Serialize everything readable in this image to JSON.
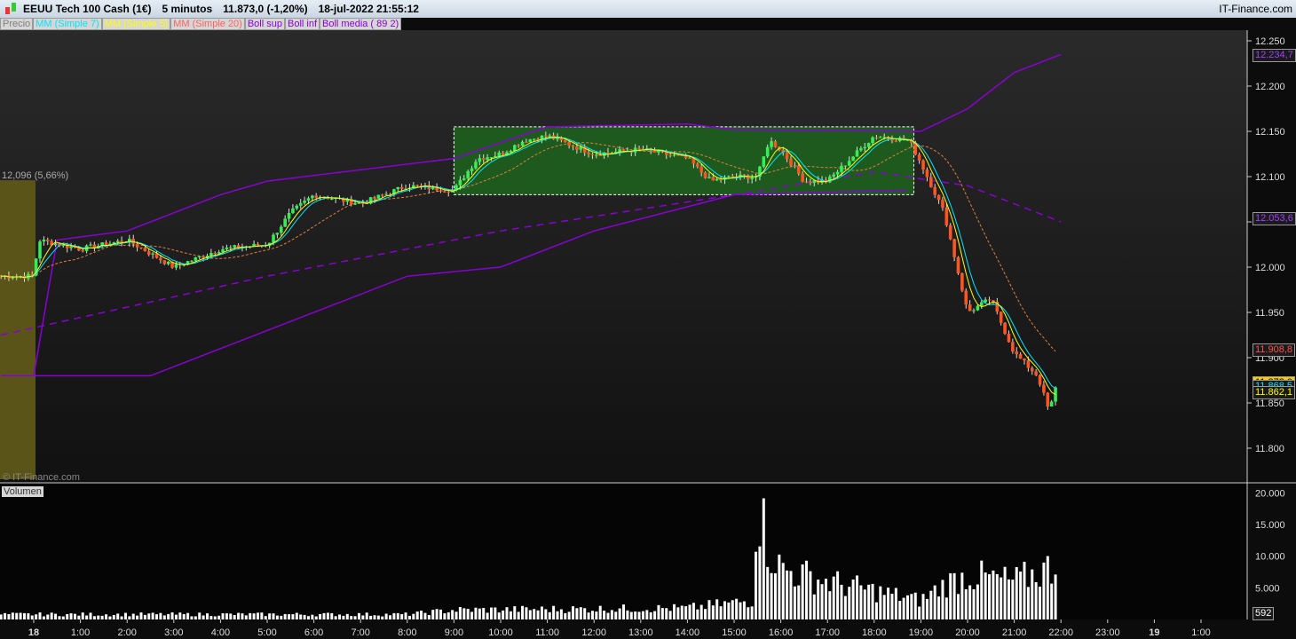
{
  "header": {
    "instrument": "EEUU Tech 100 Cash (1€)",
    "timeframe": "5 minutos",
    "price": "11.873,0 (-1,20%)",
    "datetime": "18-jul-2022 21:55:12",
    "brand": "IT-Finance.com"
  },
  "legend": [
    {
      "label": "Precio",
      "color": "#808080"
    },
    {
      "label": "MM (Simple 7)",
      "color": "#00e5ff"
    },
    {
      "label": "MM (Simple 5)",
      "color": "#ffff00"
    },
    {
      "label": "MM (Simple 20)",
      "color": "#ff6060"
    },
    {
      "label": "Boll sup",
      "color": "#8a00d4"
    },
    {
      "label": "Boll inf",
      "color": "#8a00d4"
    },
    {
      "label": "Boll media ( 89 2)",
      "color": "#8a00d4"
    }
  ],
  "watermark": "© IT-Finance.com",
  "reference_label": "12,096 (5,66%)",
  "volume_label": "Volumen",
  "price_tags": [
    {
      "text": "12.234,7",
      "value": 12234.7,
      "bg": "#1a1a1a",
      "fg": "#a040ff"
    },
    {
      "text": "12.053,6",
      "value": 12053.6,
      "bg": "#1a1a1a",
      "fg": "#a040ff"
    },
    {
      "text": "11.908,8",
      "value": 11908.8,
      "bg": "#1a1a1a",
      "fg": "#ff5050"
    },
    {
      "text": "11.873,0",
      "value": 11873,
      "bg": "#ffcc00",
      "fg": "#000"
    },
    {
      "text": "11.868,5",
      "value": 11868.5,
      "bg": "#1a1a1a",
      "fg": "#00e5ff"
    },
    {
      "text": "11.862,1",
      "value": 11862.1,
      "bg": "#1a1a1a",
      "fg": "#ffff00"
    }
  ],
  "volume_tag": "592",
  "chart_data": {
    "type": "candlestick",
    "price_axis": {
      "ticks": [
        "12.250",
        "12.200",
        "12.150",
        "12.100",
        "12.050",
        "12.000",
        "11.950",
        "11.900",
        "11.850",
        "11.800"
      ],
      "range": [
        11790,
        12270
      ]
    },
    "volume_axis": {
      "ticks": [
        "20.000",
        "15.000",
        "10.000",
        "5.000"
      ],
      "range": [
        0,
        21000
      ]
    },
    "time_axis": {
      "ticks": [
        "18",
        "1:00",
        "2:00",
        "3:00",
        "4:00",
        "5:00",
        "6:00",
        "7:00",
        "8:00",
        "9:00",
        "10:00",
        "11:00",
        "12:00",
        "13:00",
        "14:00",
        "15:00",
        "16:00",
        "17:00",
        "18:00",
        "19:00",
        "20:00",
        "21:00",
        "22:00",
        "23:00",
        "19",
        "1:00"
      ]
    },
    "close_path": [
      [
        0,
        11990
      ],
      [
        0.1,
        12030
      ],
      [
        1,
        12020
      ],
      [
        2,
        12030
      ],
      [
        3,
        12000
      ],
      [
        4,
        12020
      ],
      [
        5,
        12025
      ],
      [
        5.5,
        12060
      ],
      [
        6,
        12080
      ],
      [
        7,
        12070
      ],
      [
        8,
        12090
      ],
      [
        9,
        12085
      ],
      [
        9.5,
        12120
      ],
      [
        10,
        12125
      ],
      [
        10.5,
        12140
      ],
      [
        11,
        12145
      ],
      [
        12,
        12125
      ],
      [
        13,
        12130
      ],
      [
        14,
        12120
      ],
      [
        14.5,
        12095
      ],
      [
        15,
        12100
      ],
      [
        15.5,
        12100
      ],
      [
        15.75,
        12140
      ],
      [
        16,
        12130
      ],
      [
        16.5,
        12095
      ],
      [
        17,
        12095
      ],
      [
        17.5,
        12120
      ],
      [
        18,
        12145
      ],
      [
        18.75,
        12140
      ],
      [
        19,
        12115
      ],
      [
        19.5,
        12060
      ],
      [
        20,
        11950
      ],
      [
        20.5,
        11965
      ],
      [
        21,
        11905
      ],
      [
        21.5,
        11880
      ],
      [
        21.75,
        11840
      ],
      [
        21.92,
        11873
      ]
    ],
    "boll_sup": [
      [
        0,
        11880
      ],
      [
        0.5,
        12030
      ],
      [
        2,
        12040
      ],
      [
        4,
        12080
      ],
      [
        5,
        12095
      ],
      [
        9,
        12120
      ],
      [
        11,
        12155
      ],
      [
        14,
        12158
      ],
      [
        15,
        12152
      ],
      [
        19,
        12150
      ],
      [
        20,
        12175
      ],
      [
        21,
        12215
      ],
      [
        22,
        12235
      ]
    ],
    "boll_inf": [
      [
        -0.7,
        11880
      ],
      [
        2.5,
        11880
      ],
      [
        5.5,
        11940
      ],
      [
        8,
        11990
      ],
      [
        10,
        12000
      ],
      [
        12,
        12040
      ],
      [
        15,
        12080
      ],
      [
        18.7,
        12085
      ]
    ],
    "boll_media": [
      [
        -0.7,
        11925
      ],
      [
        5,
        11990
      ],
      [
        10,
        12040
      ],
      [
        15,
        12080
      ],
      [
        18,
        12105
      ],
      [
        20,
        12090
      ],
      [
        22,
        12050
      ]
    ],
    "annotation_box": {
      "from": 9,
      "to": 18.85,
      "high": 12155,
      "low": 12080
    },
    "reference_zone": {
      "price": 12096
    },
    "volume_path": [
      [
        0,
        800
      ],
      [
        8,
        800
      ],
      [
        9,
        1500
      ],
      [
        14,
        1800
      ],
      [
        15.4,
        3000
      ],
      [
        15.5,
        20000
      ],
      [
        15.7,
        12000
      ],
      [
        16,
        8000
      ],
      [
        17,
        6000
      ],
      [
        18,
        4500
      ],
      [
        19,
        3000
      ],
      [
        19.5,
        5500
      ],
      [
        20,
        7000
      ],
      [
        21,
        6000
      ],
      [
        21.9,
        8500
      ],
      [
        21.95,
        592
      ]
    ]
  }
}
